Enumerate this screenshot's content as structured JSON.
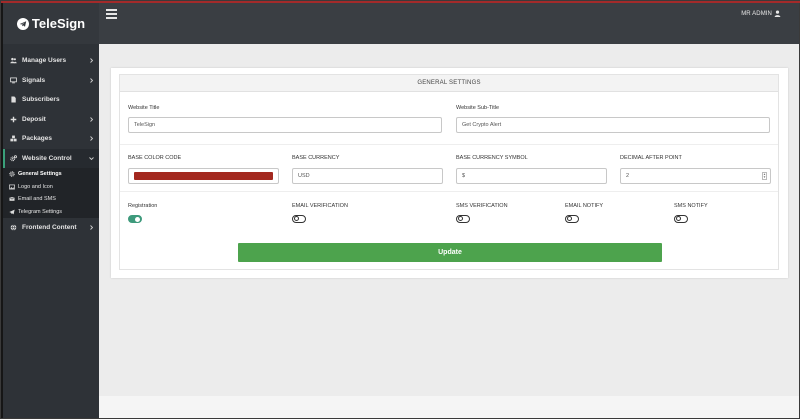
{
  "app": {
    "brand": "TeleSign",
    "user": "MR ADMIN"
  },
  "sidebar": {
    "items": [
      {
        "label": "Manage Users",
        "icon": "users-icon",
        "chevron": true
      },
      {
        "label": "Signals",
        "icon": "monitor-icon",
        "chevron": true
      },
      {
        "label": "Subscribers",
        "icon": "document-icon",
        "chevron": false
      },
      {
        "label": "Deposit",
        "icon": "plus-icon",
        "chevron": true
      },
      {
        "label": "Packages",
        "icon": "cubes-icon",
        "chevron": true
      },
      {
        "label": "Website Control",
        "icon": "cogs-icon",
        "chevron": true,
        "expanded": true
      },
      {
        "label": "Frontend Content",
        "icon": "globe-icon",
        "chevron": true
      }
    ],
    "subitems": [
      {
        "label": "General Settings",
        "icon": "gear-icon",
        "current": true
      },
      {
        "label": "Logo and Icon",
        "icon": "image-icon"
      },
      {
        "label": "Email and SMS",
        "icon": "envelope-icon"
      },
      {
        "label": "Telegram Settings",
        "icon": "paper-plane-icon"
      }
    ]
  },
  "settings": {
    "title": "GENERAL SETTINGS",
    "website_title_label": "Website Title",
    "website_title_value": "TeleSign",
    "website_subtitle_label": "Website Sub-Title",
    "website_subtitle_value": "Get Crypto Alert",
    "base_color_label": "BASE COLOR CODE",
    "base_color_value": "#a3281f",
    "base_currency_label": "BASE CURRENCY",
    "base_currency_value": "USD",
    "currency_symbol_label": "BASE CURRENCY SYMBOL",
    "currency_symbol_value": "$",
    "decimal_label": "DECIMAL AFTER POINT",
    "decimal_value": "2",
    "toggles": [
      {
        "label": "Registration",
        "on": true
      },
      {
        "label": "EMAIL VERIFICATION",
        "on": false
      },
      {
        "label": "SMS VERIFICATION",
        "on": false
      },
      {
        "label": "EMAIL NOTIFY",
        "on": false
      },
      {
        "label": "SMS NOTIFY",
        "on": false
      }
    ],
    "update_label": "Update"
  },
  "colors": {
    "accent": "#3e9a7c",
    "button": "#4da34d",
    "sidebar": "#2e3237",
    "header": "#3a3e43"
  }
}
